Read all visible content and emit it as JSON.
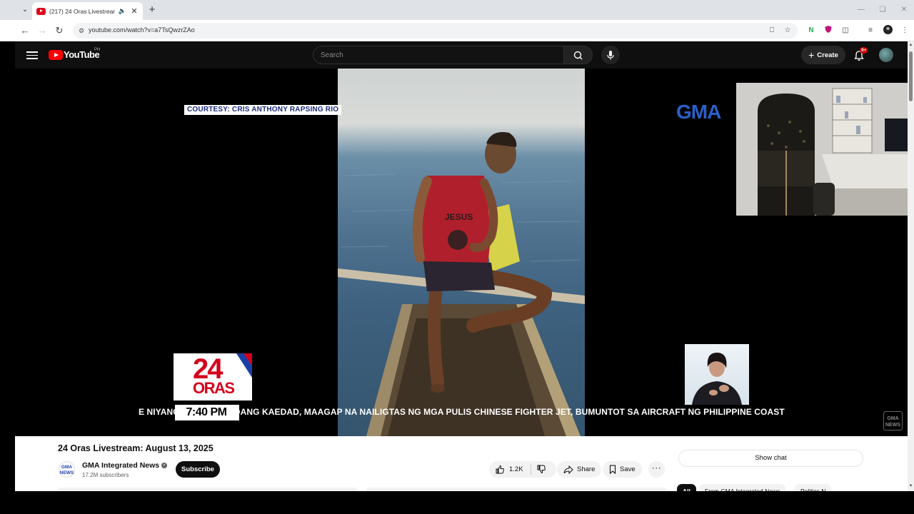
{
  "browser": {
    "tab_title": "(217) 24 Oras Livestream: A",
    "new_tab": "+",
    "url": "youtube.com/watch?v=a7TsQwzrZAo"
  },
  "youtube": {
    "logo_text": "YouTube",
    "country": "PH",
    "search_placeholder": "Search",
    "create_label": "Create",
    "notifications_badge": "9+"
  },
  "video": {
    "courtesy": "COURTESY: CRIS ANTHONY RAPSING RIO",
    "network_logo": "GMA",
    "show_number": "24",
    "show_word": "ORAS",
    "time": "7:40 PM",
    "ticker": "E NIYANG NAKATATANDANG KAEDAD, MAAGAP NA NAILIGTAS NG MGA PULIS   CHINESE FIGHTER JET, BUMUNTOT SA AIRCRAFT NG PHILIPPINE COAST GUARD",
    "shirt_text": "JESUS",
    "watermark": "GMA NEWS"
  },
  "meta": {
    "title": "24 Oras Livestream: August 13, 2025",
    "channel_name": "GMA Integrated News",
    "channel_avatar_text": "GMA NEWS",
    "subscribers": "17.2M subscribers",
    "subscribe_label": "Subscribe",
    "likes": "1.2K",
    "share_label": "Share",
    "save_label": "Save",
    "more_label": "···",
    "show_chat_label": "Show chat",
    "chips": [
      "All",
      "From GMA Integrated News",
      "Politics N"
    ]
  },
  "colors": {
    "yt_red": "#ff0000",
    "gma_red": "#d4001c",
    "gma_blue": "#2a60c8",
    "courtesy_text": "#1a2a7a"
  }
}
